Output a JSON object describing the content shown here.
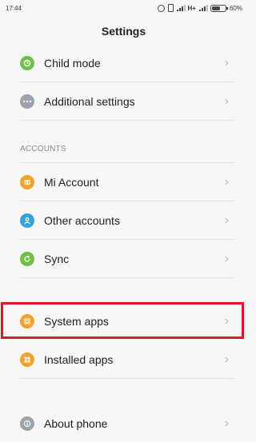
{
  "status_bar": {
    "time": "17:44",
    "network": "H+",
    "battery_percent": "60%",
    "battery_level": 0.6
  },
  "header": {
    "title": "Settings"
  },
  "items": {
    "child_mode": {
      "label": "Child mode",
      "icon": "clock-icon",
      "color": "#6fbf4a"
    },
    "additional_settings": {
      "label": "Additional settings",
      "icon": "dots-icon",
      "color": "#9aa3ad"
    },
    "mi_account": {
      "label": "Mi Account",
      "icon": "mi-icon",
      "color": "#f4a22d"
    },
    "other_accounts": {
      "label": "Other accounts",
      "icon": "person-icon",
      "color": "#36a3e0"
    },
    "sync": {
      "label": "Sync",
      "icon": "sync-icon",
      "color": "#6fbf4a"
    },
    "system_apps": {
      "label": "System apps",
      "icon": "grid-icon",
      "color": "#f4a22d"
    },
    "installed_apps": {
      "label": "Installed apps",
      "icon": "apps-icon",
      "color": "#f4a22d"
    },
    "about_phone": {
      "label": "About phone",
      "icon": "info-icon",
      "color": "#9aa3ad"
    }
  },
  "sections": {
    "accounts": "ACCOUNTS"
  },
  "chevron": "›",
  "highlight_color": "#e8121d"
}
